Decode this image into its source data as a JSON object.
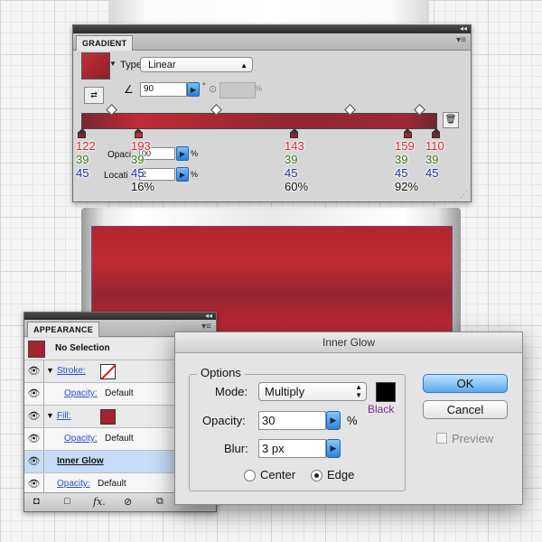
{
  "gradient_panel": {
    "tab_title": "GRADIENT",
    "tab_close": "×",
    "panel_menu_icon": "panel-menu-icon",
    "type_label": "Type",
    "type_value": "Linear",
    "angle_value": "90",
    "angle_unit": "°",
    "aspect_unit": "%",
    "opacity_label": "Opaci",
    "opacity_value": "00",
    "opacity_unit": "%",
    "location_label": "Locati",
    "location_value": "2",
    "location_unit": "%",
    "stops": [
      {
        "color": "#7a2730",
        "position": 0.0
      },
      {
        "color": "#c12b35",
        "position": 0.16
      },
      {
        "color": "#8f2732",
        "position": 0.6
      },
      {
        "color": "#9f2734",
        "position": 0.92
      },
      {
        "color": "#6e272d",
        "position": 1.0
      }
    ]
  },
  "annotations": [
    {
      "r": "122",
      "g": "39",
      "b": "45",
      "loc": ""
    },
    {
      "r": "193",
      "g": "39",
      "b": "45",
      "loc": "16%"
    },
    {
      "r": "143",
      "g": "39",
      "b": "45",
      "loc": "60%"
    },
    {
      "r": "159",
      "g": "39",
      "b": "45",
      "loc": "92%"
    },
    {
      "r": "110",
      "g": "39",
      "b": "45",
      "loc": ""
    }
  ],
  "appearance_panel": {
    "tab_title": "APPEARANCE",
    "tab_close": "×",
    "no_selection": "No Selection",
    "stroke_label": "Stroke:",
    "opacity_link": "Opacity:",
    "opacity_value": "Default",
    "fill_label": "Fill:",
    "inner_glow": "Inner Glow",
    "fill_color": "#a52230"
  },
  "inner_glow_dialog": {
    "title": "Inner Glow",
    "options_legend": "Options",
    "mode_label": "Mode:",
    "mode_value": "Multiply",
    "color_caption": "Black",
    "opacity_label": "Opacity:",
    "opacity_value": "30",
    "opacity_unit": "%",
    "blur_label": "Blur:",
    "blur_value": "3 px",
    "center_label": "Center",
    "edge_label": "Edge",
    "selected_source": "Edge",
    "ok_label": "OK",
    "cancel_label": "Cancel",
    "preview_label": "Preview",
    "preview_checked": false
  },
  "colors": {
    "artwork_red": "#a52230",
    "accent_blue": "#3d8fe6",
    "black_caption": "#7a2aa0"
  }
}
